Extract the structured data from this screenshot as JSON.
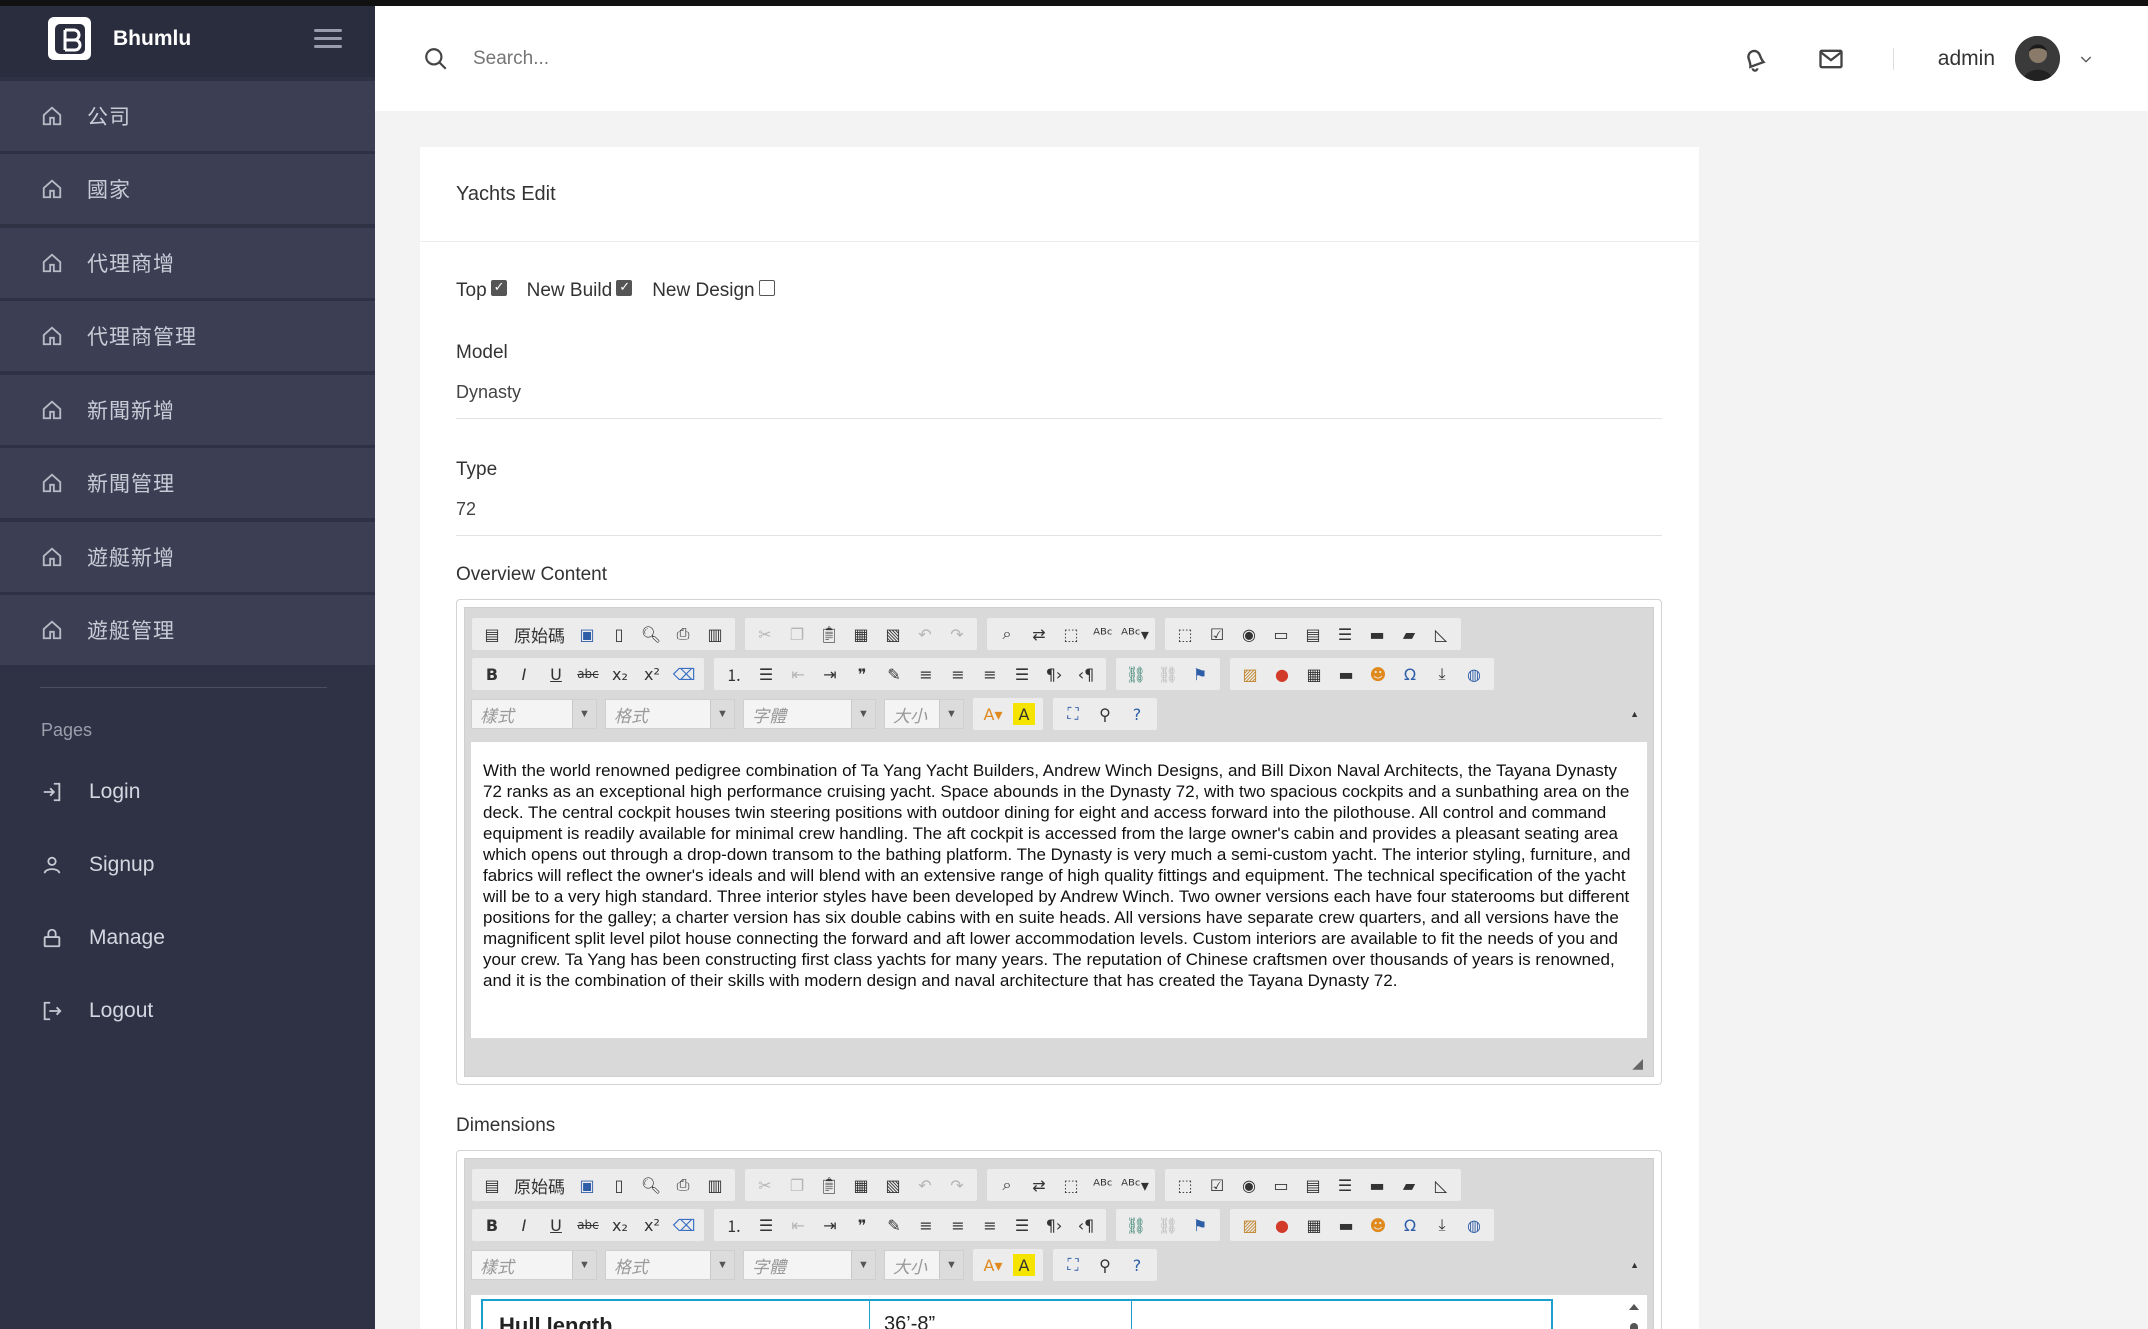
{
  "app": {
    "name": "Bhumlu"
  },
  "sidebar": {
    "items": [
      {
        "label": "公司",
        "icon": "home-icon"
      },
      {
        "label": "國家",
        "icon": "home-icon"
      },
      {
        "label": "代理商增",
        "icon": "home-icon"
      },
      {
        "label": "代理商管理",
        "icon": "home-icon"
      },
      {
        "label": "新聞新增",
        "icon": "home-icon"
      },
      {
        "label": "新聞管理",
        "icon": "home-icon"
      },
      {
        "label": "遊艇新增",
        "icon": "home-icon"
      },
      {
        "label": "遊艇管理",
        "icon": "home-icon"
      }
    ],
    "pages_title": "Pages",
    "pages": [
      {
        "label": "Login",
        "icon": "login-icon"
      },
      {
        "label": "Signup",
        "icon": "user-icon"
      },
      {
        "label": "Manage",
        "icon": "lock-icon"
      },
      {
        "label": "Logout",
        "icon": "logout-icon"
      }
    ]
  },
  "header": {
    "search_placeholder": "Search...",
    "username": "admin"
  },
  "card": {
    "title": "Yachts Edit",
    "checks": [
      {
        "label": "Top",
        "checked": true
      },
      {
        "label": "New Build",
        "checked": true
      },
      {
        "label": "New Design",
        "checked": false
      }
    ],
    "model_label": "Model",
    "model_value": "Dynasty",
    "type_label": "Type",
    "type_value": "72",
    "overview_label": "Overview Content",
    "overview_text": "With the world renowned pedigree combination of Ta Yang Yacht Builders, Andrew Winch Designs, and Bill Dixon Naval Architects, the Tayana Dynasty 72 ranks as an exceptional high performance cruising yacht. Space abounds in the Dynasty 72, with two spacious cockpits and a sunbathing area on the deck. The central cockpit houses twin steering positions with outdoor dining for eight and access forward into the pilothouse. All control and command equipment is readily available for minimal crew handling. The aft cockpit is accessed from the large owner's cabin and provides a pleasant seating area which opens out through a drop-down transom to the bathing platform. The Dynasty is very much a semi-custom yacht. The interior styling, furniture, and fabrics will reflect the owner's ideals and will blend with an extensive range of high quality fittings and equipment. The technical specification of the yacht will be to a very high standard. Three interior styles have been developed by Andrew Winch. Two owner versions each have four staterooms but different positions for the galley; a charter version has six double cabins with en suite heads. All versions have separate crew quarters, and all versions have the magnificent split level pilot house connecting the forward and aft lower accommodation levels. Custom interiors are available to fit the needs of you and your crew. Ta Yang has been constructing first class yachts for many years. The reputation of Chinese craftsmen over thousands of years is renowned, and it is the combination of their skills with modern design and naval architecture that has created the Tayana Dynasty 72.",
    "dimensions_label": "Dimensions",
    "dimensions_row": {
      "name": "Hull length",
      "value": "36’-8”"
    }
  },
  "editor": {
    "source_label": "原始碼",
    "style_combo": "樣式",
    "format_combo": "格式",
    "font_combo": "字體",
    "size_combo": "大小"
  }
}
